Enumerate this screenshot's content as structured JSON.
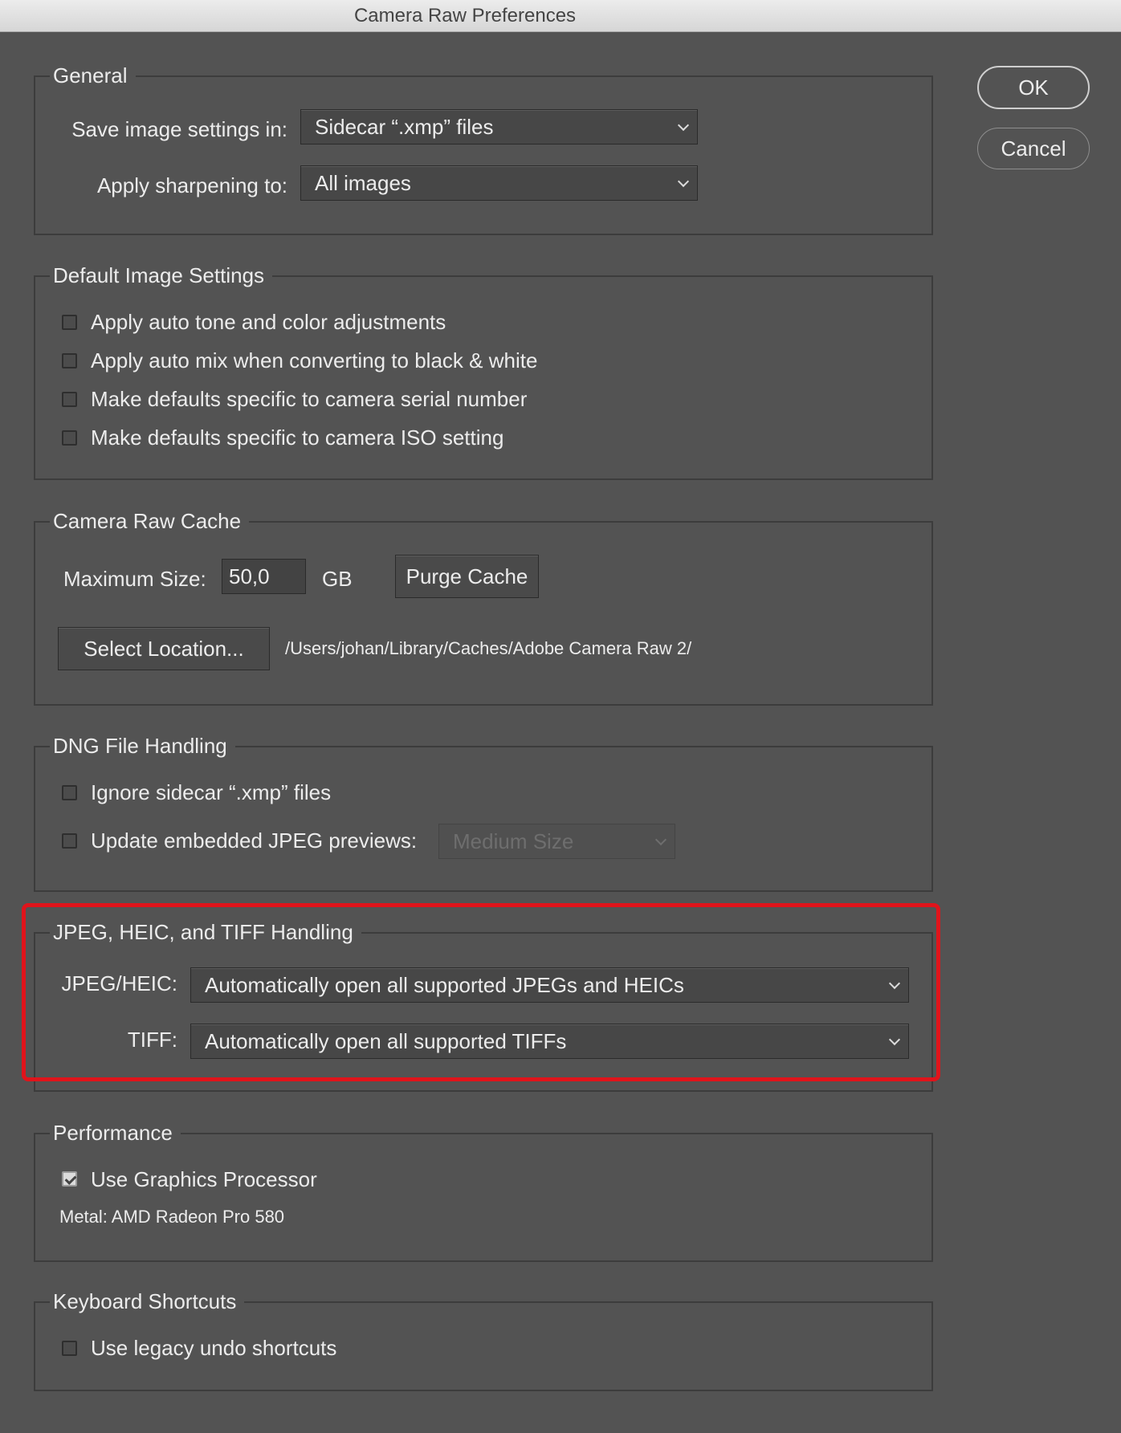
{
  "window": {
    "title": "Camera Raw Preferences"
  },
  "buttons": {
    "ok": "OK",
    "cancel": "Cancel"
  },
  "general": {
    "legend": "General",
    "save_label": "Save image settings in:",
    "save_value": "Sidecar “.xmp” files",
    "sharpen_label": "Apply sharpening to:",
    "sharpen_value": "All images"
  },
  "defaults": {
    "legend": "Default Image Settings",
    "items": [
      {
        "label": "Apply auto tone and color adjustments",
        "checked": false
      },
      {
        "label": "Apply auto mix when converting to black & white",
        "checked": false
      },
      {
        "label": "Make defaults specific to camera serial number",
        "checked": false
      },
      {
        "label": "Make defaults specific to camera ISO setting",
        "checked": false
      }
    ]
  },
  "cache": {
    "legend": "Camera Raw Cache",
    "max_label": "Maximum Size:",
    "max_value": "50,0",
    "unit": "GB",
    "purge": "Purge Cache",
    "select_location": "Select Location...",
    "path": "/Users/johan/Library/Caches/Adobe Camera Raw 2/"
  },
  "dng": {
    "legend": "DNG File Handling",
    "ignore_label": "Ignore sidecar “.xmp” files",
    "ignore_checked": false,
    "update_label": "Update embedded JPEG previews:",
    "update_checked": false,
    "preview_value": "Medium Size"
  },
  "jpeg": {
    "legend": "JPEG, HEIC, and TIFF Handling",
    "jpeg_label": "JPEG/HEIC:",
    "jpeg_value": "Automatically open all supported JPEGs and HEICs",
    "tiff_label": "TIFF:",
    "tiff_value": "Automatically open all supported TIFFs"
  },
  "performance": {
    "legend": "Performance",
    "gpu_label": "Use Graphics Processor",
    "gpu_checked": true,
    "metal": "Metal: AMD Radeon Pro 580"
  },
  "keyboard": {
    "legend": "Keyboard Shortcuts",
    "legacy_label": "Use legacy undo shortcuts",
    "legacy_checked": false
  },
  "colors": {
    "background": "#535353",
    "highlight": "#e0141b"
  }
}
